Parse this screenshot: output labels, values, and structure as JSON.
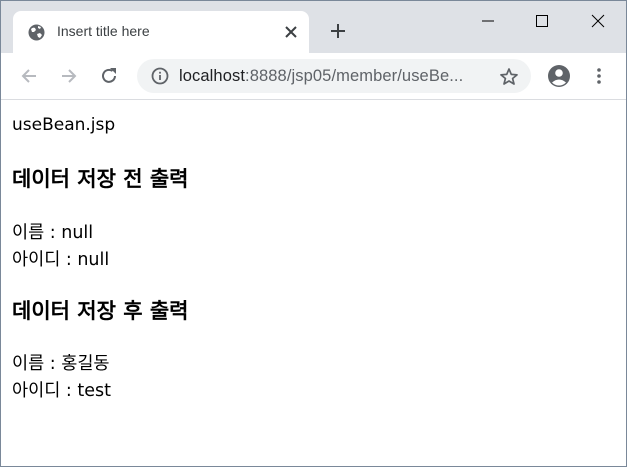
{
  "tab": {
    "title": "Insert title here",
    "favicon": "globe-icon",
    "close": "close-icon"
  },
  "window_controls": [
    "minimize-icon",
    "maximize-icon",
    "close-icon"
  ],
  "address": {
    "host": "localhost",
    "path": ":8888/jsp05/member/useBe..."
  },
  "page": {
    "filename": "useBean.jsp",
    "before_heading": "데이터 저장 전 출력",
    "before_name_label": "이름 : ",
    "before_name_value": "null",
    "before_id_label": "아이디 : ",
    "before_id_value": "null",
    "after_heading": "데이터 저장 후 출력",
    "after_name_label": "이름 : ",
    "after_name_value": "홍길동",
    "after_id_label": "아이디 : ",
    "after_id_value": "test"
  },
  "colors": {
    "tabstrip": "#dee1e6",
    "omnibox": "#f1f3f4",
    "icon": "#5f6368"
  }
}
